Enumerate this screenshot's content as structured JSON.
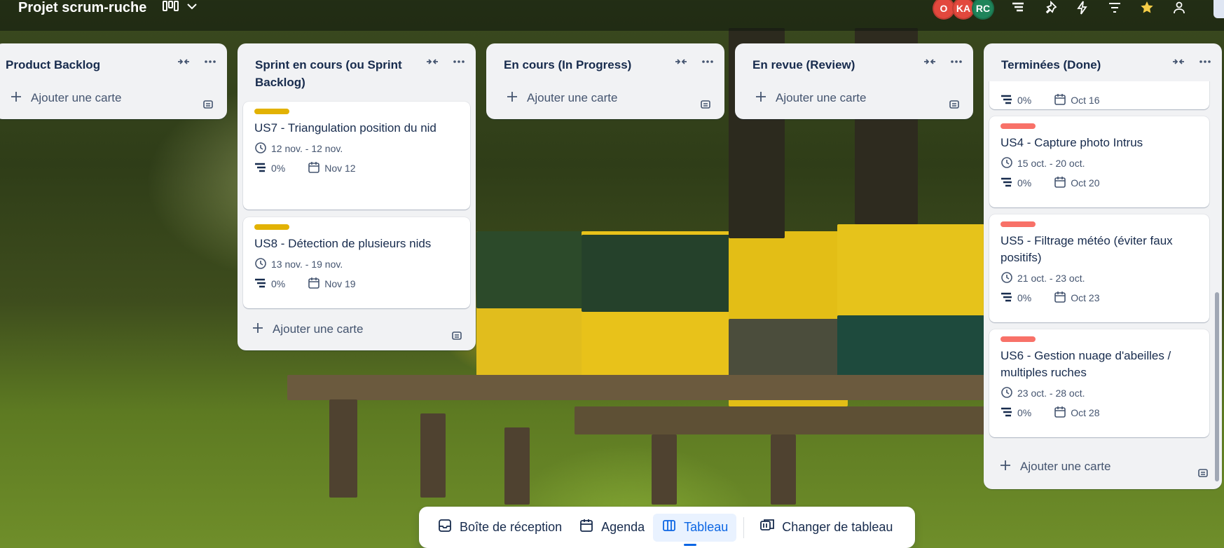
{
  "board": {
    "title": "Projet scrum-ruche",
    "view_icon": "board-view-icon",
    "view_chevron": "chevron-down-icon"
  },
  "members": [
    {
      "initials": "O",
      "color": "#e2483d"
    },
    {
      "initials": "KA",
      "color": "#e2483d"
    },
    {
      "initials": "RC",
      "color": "#1f845a"
    }
  ],
  "top_icons": [
    "filter-icon",
    "power-ups-icon",
    "automation-icon",
    "filter-lines-icon",
    "star-icon",
    "share-icon"
  ],
  "lists": [
    {
      "name": "Product Backlog",
      "add_label": "Ajouter une carte",
      "cards": []
    },
    {
      "name": "Sprint en cours (ou Sprint Backlog)",
      "add_label": "Ajouter une carte",
      "cards": [
        {
          "label_color": "#e2b203",
          "title": "US7 - Triangulation position du nid",
          "dates": "12 nov. - 12 nov.",
          "progress": "0%",
          "due": "Nov 12"
        },
        {
          "label_color": "#e2b203",
          "title": "US8 - Détection de plusieurs nids",
          "dates": "13 nov. - 19 nov.",
          "progress": "0%",
          "due": "Nov 19"
        }
      ]
    },
    {
      "name": "En cours (In Progress)",
      "add_label": "Ajouter une carte",
      "cards": []
    },
    {
      "name": "En revue (Review)",
      "add_label": "Ajouter une carte",
      "cards": []
    },
    {
      "name": "Terminées (Done)",
      "add_label": "Ajouter une carte",
      "cards": [
        {
          "label_color": "#f87168",
          "title": "",
          "dates": "",
          "progress": "0%",
          "due": "Oct 16"
        },
        {
          "label_color": "#f87168",
          "title": "US4 - Capture photo Intrus",
          "dates": "15 oct. - 20 oct.",
          "progress": "0%",
          "due": "Oct 20"
        },
        {
          "label_color": "#f87168",
          "title": "US5 - Filtrage météo (éviter faux positifs)",
          "dates": "21 oct. - 23 oct.",
          "progress": "0%",
          "due": "Oct 23"
        },
        {
          "label_color": "#f87168",
          "title": "US6 - Gestion nuage d'abeilles / multiples ruches",
          "dates": "23 oct. - 28 oct.",
          "progress": "0%",
          "due": "Oct 28"
        }
      ]
    }
  ],
  "bottom_nav": {
    "inbox": "Boîte de réception",
    "planner": "Agenda",
    "board": "Tableau",
    "switch": "Changer de tableau"
  }
}
